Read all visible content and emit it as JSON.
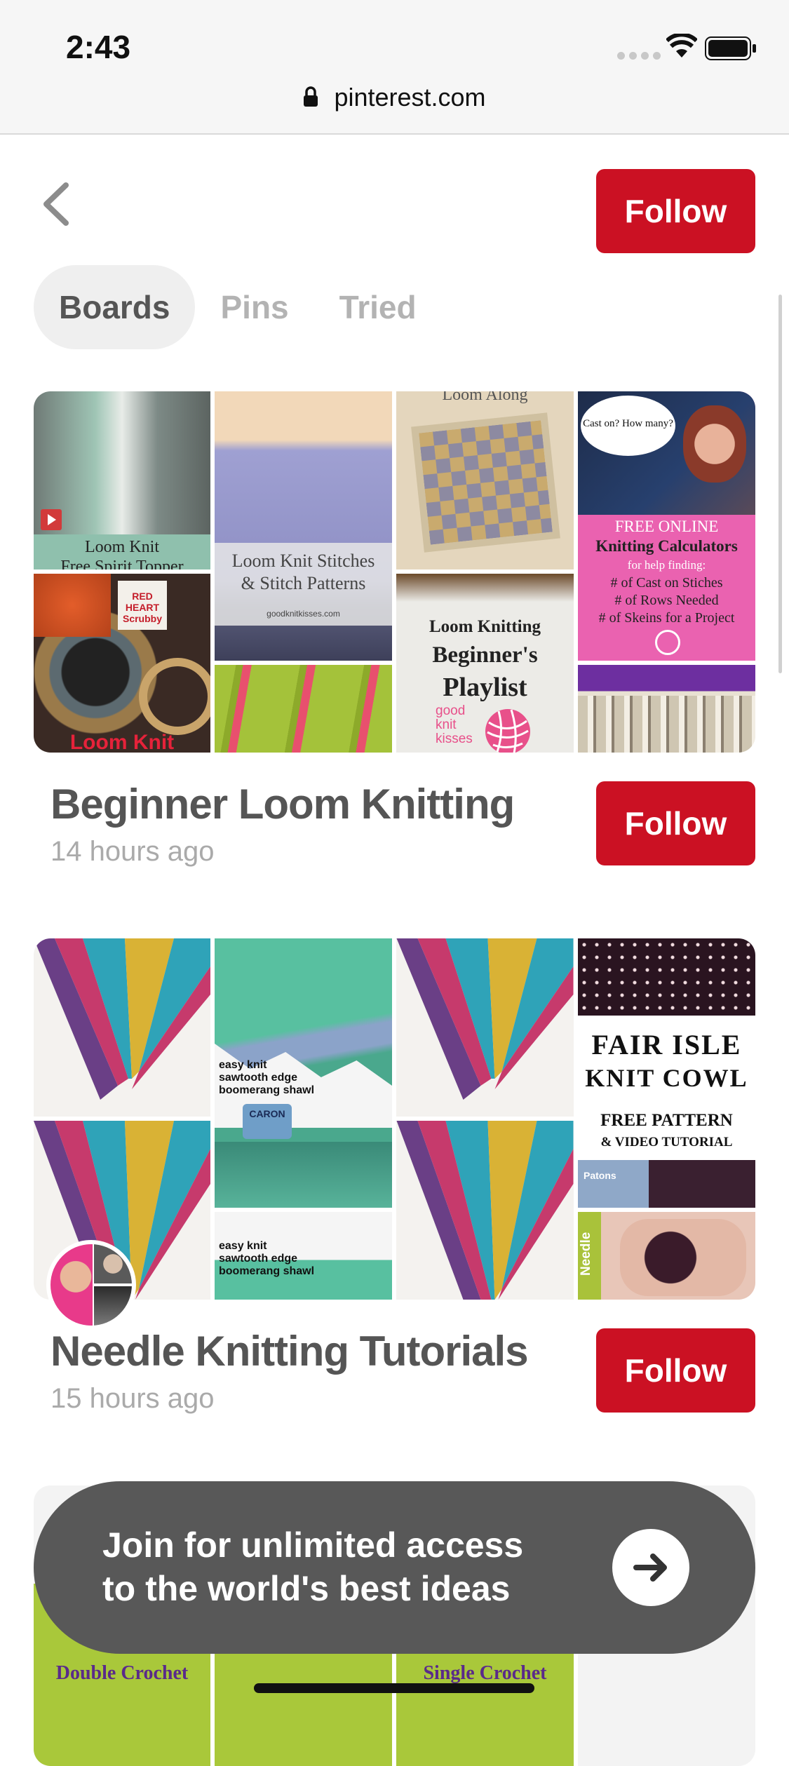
{
  "status": {
    "time": "2:43",
    "url": "pinterest.com"
  },
  "header": {
    "follow_label": "Follow"
  },
  "tabs": [
    {
      "label": "Boards",
      "active": true
    },
    {
      "label": "Pins",
      "active": false
    },
    {
      "label": "Tried",
      "active": false
    }
  ],
  "boards": [
    {
      "title": "Beginner Loom Knitting",
      "time": "14 hours ago",
      "follow_label": "Follow",
      "thumb_text": {
        "loom_knit_topper": "Loom Knit\nFree Spirit Topper",
        "stitches": "Loom Knit Stitches\n& Stitch Patterns",
        "stitches_site": "goodknitkisses.com",
        "along": "Loom Along",
        "playlist_1": "Loom Knitting",
        "playlist_2": "Beginner's",
        "playlist_3": "Playlist",
        "brand": "good\nknit\nkisses",
        "calc_free": "FREE ONLINE",
        "calc_title": "Knitting Calculators",
        "calc_help": "for help finding:",
        "calc_items": [
          "# of Cast on Stiches",
          "# of Rows Needed",
          "# of Skeins for a Project"
        ],
        "bubble": "Cast on?  How many?",
        "loom_knit": "Loom Knit",
        "red_heart": "RED HEART\nScrubby"
      }
    },
    {
      "title": "Needle Knitting Tutorials",
      "time": "15 hours ago",
      "follow_label": "Follow",
      "thumb_text": {
        "shawl_1": "easy knit\nsawtooth edge\nboomerang shawl",
        "shawl_2": "easy knit\nsawtooth edge\nboomerang shawl",
        "fair_isle_1": "FAIR ISLE",
        "fair_isle_2": "KNIT COWL",
        "fair_isle_3": "FREE PATTERN",
        "fair_isle_4": "& VIDEO TUTORIAL",
        "needle": "Needle",
        "caron": "CARON",
        "patons": "Patons"
      }
    },
    {
      "title": "",
      "time": "",
      "thumb_text": {
        "double_crochet": "Double Crochet",
        "single_crochet": "Single Crochet"
      }
    }
  ],
  "banner": {
    "line1": "Join for unlimited access",
    "line2": "to the world's best ideas"
  },
  "colors": {
    "brand_red": "#cb1123",
    "banner_gray": "#585858",
    "tab_active_bg": "#efefef"
  },
  "icons": [
    "lock-icon",
    "wifi-icon",
    "battery-icon",
    "back-chevron-icon",
    "play-icon",
    "arrow-right-icon",
    "yarn-ball-icon"
  ]
}
